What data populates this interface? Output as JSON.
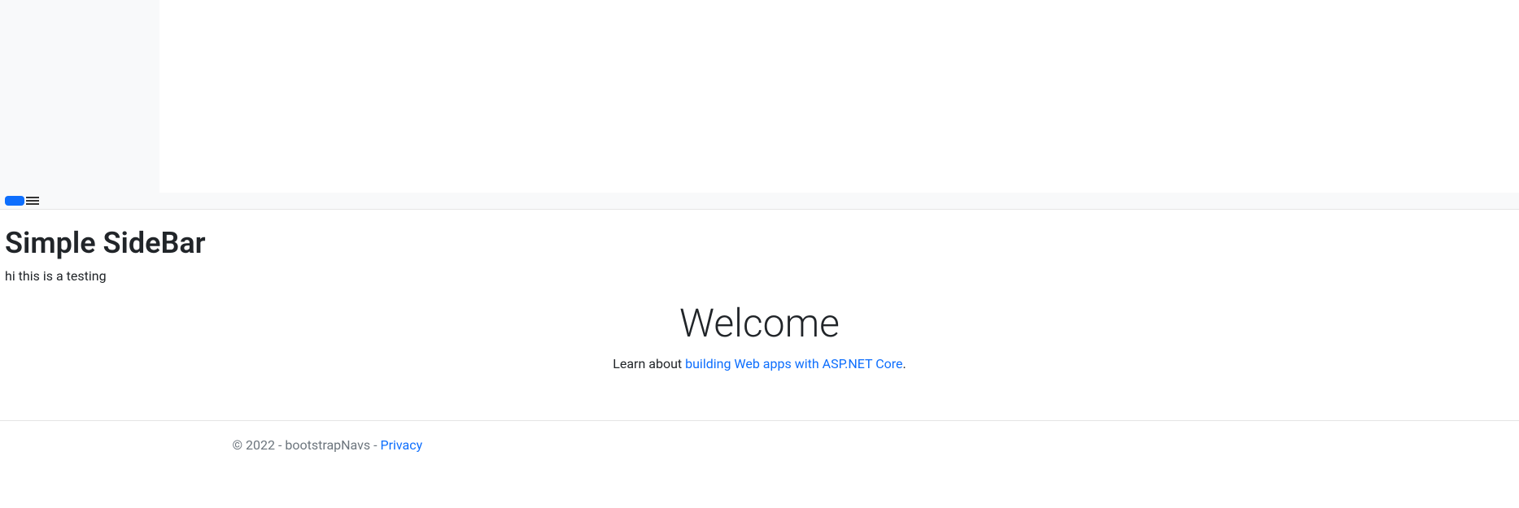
{
  "page": {
    "title": "Simple SideBar",
    "subtitle": "hi this is a testing"
  },
  "welcome": {
    "heading": "Welcome",
    "text_prefix": "Learn about ",
    "link_text": "building Web apps with ASP.NET Core",
    "text_suffix": "."
  },
  "footer": {
    "copyright": "© 2022 - bootstrapNavs ",
    "dash": "- ",
    "privacy_label": "Privacy"
  }
}
